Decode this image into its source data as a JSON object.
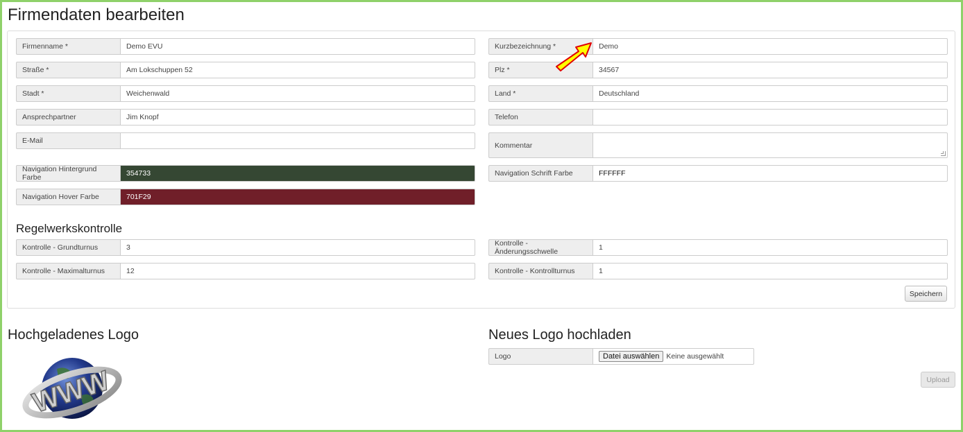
{
  "page_title": "Firmendaten bearbeiten",
  "form": {
    "firmenname": {
      "label": "Firmenname *",
      "value": "Demo EVU"
    },
    "kurzbezeichnung": {
      "label": "Kurzbezeichnung *",
      "value": "Demo"
    },
    "strasse": {
      "label": "Straße *",
      "value": "Am Lokschuppen 52"
    },
    "plz": {
      "label": "Plz *",
      "value": "34567"
    },
    "stadt": {
      "label": "Stadt *",
      "value": "Weichenwald"
    },
    "land": {
      "label": "Land *",
      "value": "Deutschland"
    },
    "ansprechpartner": {
      "label": "Ansprechpartner",
      "value": "Jim Knopf"
    },
    "telefon": {
      "label": "Telefon",
      "value": ""
    },
    "email": {
      "label": "E-Mail",
      "value": ""
    },
    "kommentar": {
      "label": "Kommentar",
      "value": ""
    },
    "nav_bg": {
      "label": "Navigation Hintergrund Farbe",
      "value": "354733"
    },
    "nav_font": {
      "label": "Navigation Schrift Farbe",
      "value": "FFFFFF"
    },
    "nav_hover": {
      "label": "Navigation Hover Farbe",
      "value": "701F29"
    }
  },
  "regelwerk": {
    "title": "Regelwerkskontrolle",
    "grundturnus": {
      "label": "Kontrolle - Grundturnus",
      "value": "3"
    },
    "aenderungsschwelle": {
      "label": "Kontrolle - Änderungsschwelle",
      "value": "1"
    },
    "maximalturnus": {
      "label": "Kontrolle - Maximalturnus",
      "value": "12"
    },
    "kontrollturnus": {
      "label": "Kontrolle - Kontrollturnus",
      "value": "1"
    },
    "save_label": "Speichern"
  },
  "logo_section": {
    "uploaded_title": "Hochgeladenes Logo",
    "new_title": "Neues Logo hochladen",
    "logo_label": "Logo",
    "file_button": "Datei auswählen",
    "file_status": "Keine ausgewählt",
    "upload_label": "Upload",
    "logo_image_text": "WWW"
  },
  "colors": {
    "nav_bg": "#354733",
    "nav_hover": "#701F29",
    "frame": "#8fd16a",
    "arrow_fill": "#ffff00",
    "arrow_stroke": "#e00000"
  }
}
